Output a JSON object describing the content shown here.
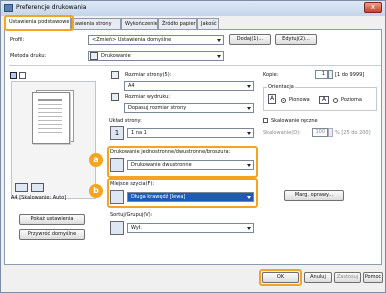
{
  "window": {
    "title": "Preferencje drukowania",
    "close_glyph": "x"
  },
  "tabs": [
    {
      "label": "Ustawienia podstawowe"
    },
    {
      "label": "awienia strony"
    },
    {
      "label": "Wykończenie"
    },
    {
      "label": "Źródło papieru"
    },
    {
      "label": "Jakość"
    }
  ],
  "profile": {
    "label": "Profil:",
    "value": "<Zmień> Ustawienia domyślne",
    "add_label": "Dodaj(1)...",
    "edit_label": "Edytuj(2)..."
  },
  "print_method": {
    "label": "Metoda druku:",
    "value": "Drukowanie"
  },
  "page_size": {
    "label": "Rozmiar strony(5):",
    "value": "A4"
  },
  "output_size": {
    "label": "Rozmiar wydruku:",
    "value": "Dopasuj rozmiar strony"
  },
  "layout": {
    "label": "Układ strony:",
    "value": "1 na 1",
    "icon_text": "1"
  },
  "copies": {
    "label": "Kopie:",
    "value": "1",
    "range": "[1 do 9999]"
  },
  "orientation": {
    "label": "Orientacja",
    "portrait": "Pionowa",
    "landscape": "Pozioma",
    "portrait_icon_text": "A",
    "landscape_icon_text": "A"
  },
  "manual_scaling": {
    "label": "Skalowanie ręczne",
    "scale_label": "Skalowanie(D):",
    "scale_value": "100",
    "scale_range": "% [25 do 200]"
  },
  "duplex": {
    "label": "Drukowanie jednostronne/dwustronne/broszura:",
    "value": "Drukowanie dwustronne"
  },
  "binding": {
    "label": "Miejsce szycia(F):",
    "value": "Długa krawędź [lewa]",
    "margin_button": "Marg. oprawy..."
  },
  "sort": {
    "label": "Sortuj/Grupuj(V):",
    "value": "Wył."
  },
  "preview": {
    "status": "A4 [Skalowanie: Auto]"
  },
  "left_buttons": {
    "show_settings": "Pokaż ustawienia",
    "restore_defaults": "Przywróć domyślne"
  },
  "markers": {
    "a": "a",
    "b": "b"
  },
  "footer": {
    "ok": "OK",
    "cancel": "Anuluj",
    "apply": "Zastosuj",
    "help": "Pomoc"
  },
  "colors": {
    "accent": "#f4a421",
    "highlight": "#1e5bb8"
  }
}
